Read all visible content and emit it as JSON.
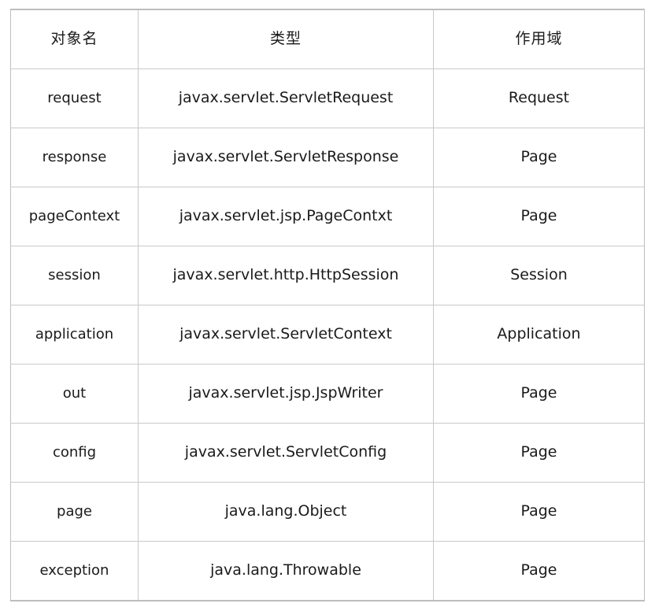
{
  "table": {
    "columns": [
      {
        "key": "name",
        "label": "对象名"
      },
      {
        "key": "type",
        "label": "类型"
      },
      {
        "key": "scope",
        "label": "作用域"
      }
    ],
    "rows": [
      {
        "name": "request",
        "type": "javax.servlet.ServletRequest",
        "scope": "Request"
      },
      {
        "name": "response",
        "type": "javax.servlet.ServletResponse",
        "scope": "Page"
      },
      {
        "name": "pageContext",
        "type": "javax.servlet.jsp.PageContxt",
        "scope": "Page"
      },
      {
        "name": "session",
        "type": "javax.servlet.http.HttpSession",
        "scope": "Session"
      },
      {
        "name": "application",
        "type": "javax.servlet.ServletContext",
        "scope": "Application"
      },
      {
        "name": "out",
        "type": "javax.servlet.jsp.JspWriter",
        "scope": "Page"
      },
      {
        "name": "config",
        "type": "javax.servlet.ServletConfig",
        "scope": "Page"
      },
      {
        "name": "page",
        "type": "java.lang.Object",
        "scope": "Page"
      },
      {
        "name": "exception",
        "type": "java.lang.Throwable",
        "scope": "Page"
      }
    ]
  },
  "style": {
    "background": "#ffffff",
    "text_color": "#1a1a1a",
    "grid_line": "#c9c9c9",
    "outer_line": "#bdbdbd"
  }
}
